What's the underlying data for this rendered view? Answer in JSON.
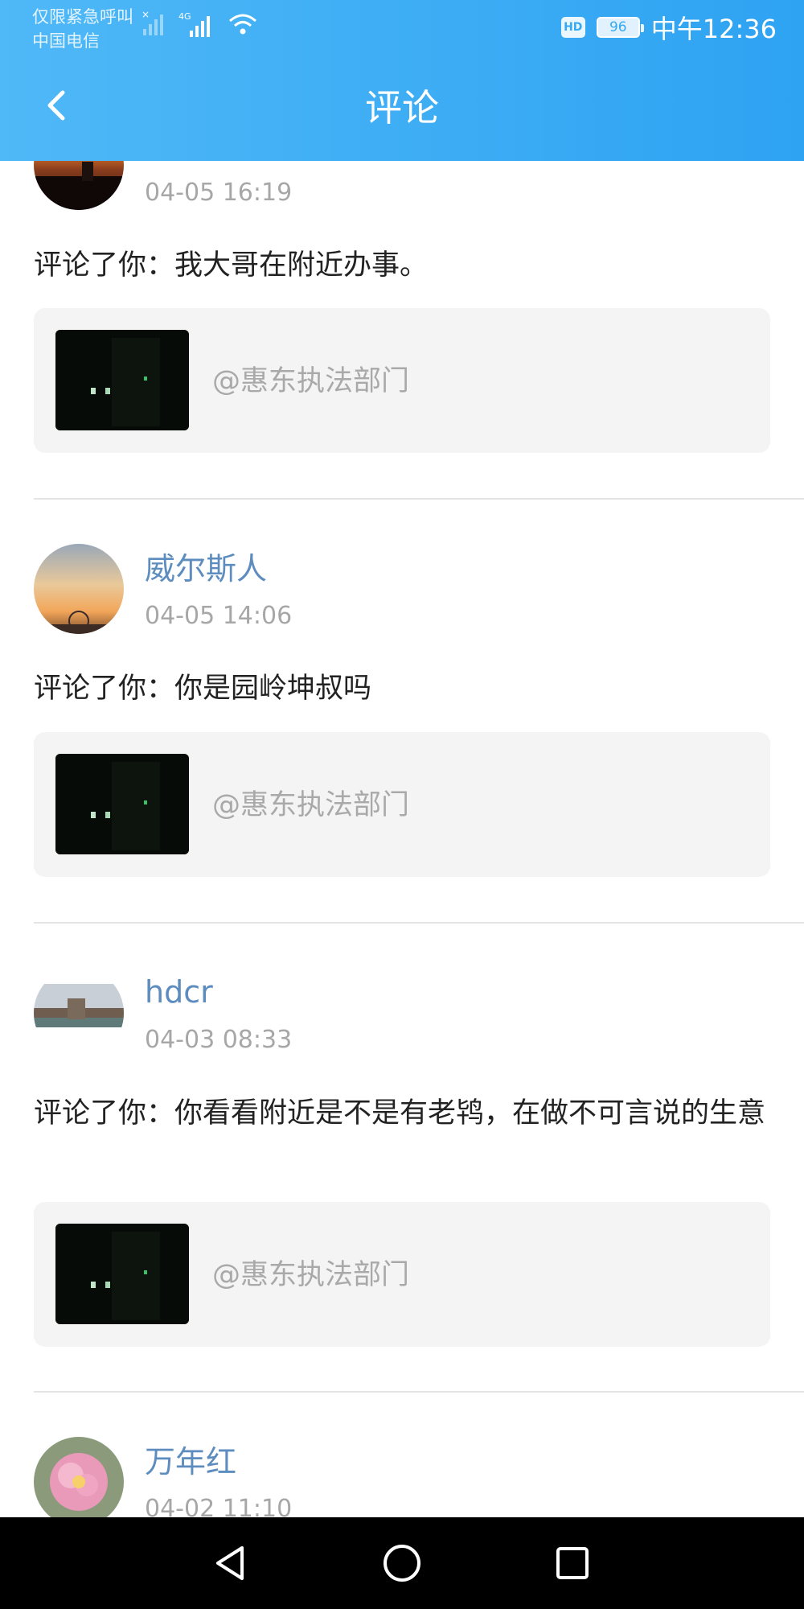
{
  "status_bar": {
    "carrier_line1": "仅限紧急呼叫",
    "carrier_line2": "中国电信",
    "network": "4G",
    "hd": "HD",
    "battery": "96",
    "time": "中午12:36"
  },
  "header": {
    "title": "评论",
    "back_icon": "chevron-left-icon"
  },
  "comments": [
    {
      "name": "",
      "date": "04-05 16:19",
      "text": "评论了你：我大哥在附近办事。",
      "quote": "@惠东执法部门"
    },
    {
      "name": "威尔斯人",
      "date": "04-05 14:06",
      "text": "评论了你：你是园岭坤叔吗",
      "quote": "@惠东执法部门"
    },
    {
      "name": "hdcr",
      "date": "04-03 08:33",
      "text": "评论了你：你看看附近是不是有老鸨，在做不可言说的生意",
      "quote": "@惠东执法部门"
    },
    {
      "name": "万年红",
      "date": "04-02 11:10"
    }
  ],
  "nav_bar": {
    "back_icon": "triangle-back-icon",
    "home_icon": "circle-home-icon",
    "recents_icon": "square-recents-icon"
  },
  "colors": {
    "header": "#2ea3f2",
    "name": "#5d8cbf",
    "date": "#a7a7a7",
    "card_bg": "#f4f4f4"
  }
}
